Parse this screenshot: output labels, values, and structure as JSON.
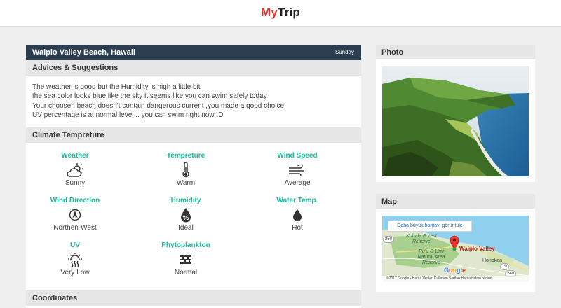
{
  "header": {
    "logo_my": "My",
    "logo_trip": "Trip"
  },
  "main": {
    "title": "Waipio Valley Beach, Hawaii",
    "day": "Sunday",
    "advices_title": "Advices & Suggestions",
    "advices": [
      "The weather is good but the Humidity is high a little bit",
      "the sea color looks blue like the sky  it seems like you can swim safely today",
      "Your choosen beach doesn't contain dangerous current ,you made a good choice",
      "UV percentage is at normal level .. you can swim right now :D"
    ],
    "climate_title": "Climate Tempreture",
    "climate": [
      {
        "label": "Weather",
        "value": "Sunny",
        "icon": "partly-sunny-icon"
      },
      {
        "label": "Tempreture",
        "value": "Warm",
        "icon": "thermometer-icon"
      },
      {
        "label": "Wind Speed",
        "value": "Average",
        "icon": "wind-icon"
      },
      {
        "label": "Wind Direction",
        "value": "Northen-West",
        "icon": "compass-icon"
      },
      {
        "label": "Humidity",
        "value": "Ideal",
        "icon": "percent-drop-icon"
      },
      {
        "label": "Water Temp.",
        "value": "Hot",
        "icon": "water-drop-icon"
      },
      {
        "label": "UV",
        "value": "Very Low",
        "icon": "sun-heat-icon"
      },
      {
        "label": "Phytoplankton",
        "value": "Normal",
        "icon": "plankton-icon"
      }
    ],
    "coordinates_title": "Coordinates"
  },
  "photo": {
    "title": "Photo"
  },
  "map": {
    "title": "Map",
    "button": "Daha büyük haritayı görüntüle",
    "pin_label": "Waipio Valley",
    "labels": [
      "Kohala Forest Reserve",
      "Pu'u O Umi Natural Area Reserve"
    ],
    "town": "Honokaa",
    "road_numbers": [
      "250",
      "19",
      "240"
    ],
    "google_letters": [
      "G",
      "o",
      "o",
      "g",
      "l",
      "e"
    ],
    "footer": "©2017 Google - Harita Verileri     Kullanım Şartları     Harita hatası bildirin"
  },
  "colors": {
    "navy": "#2c3e50",
    "accent": "#1abc9c",
    "logo_red": "#e0322e"
  }
}
